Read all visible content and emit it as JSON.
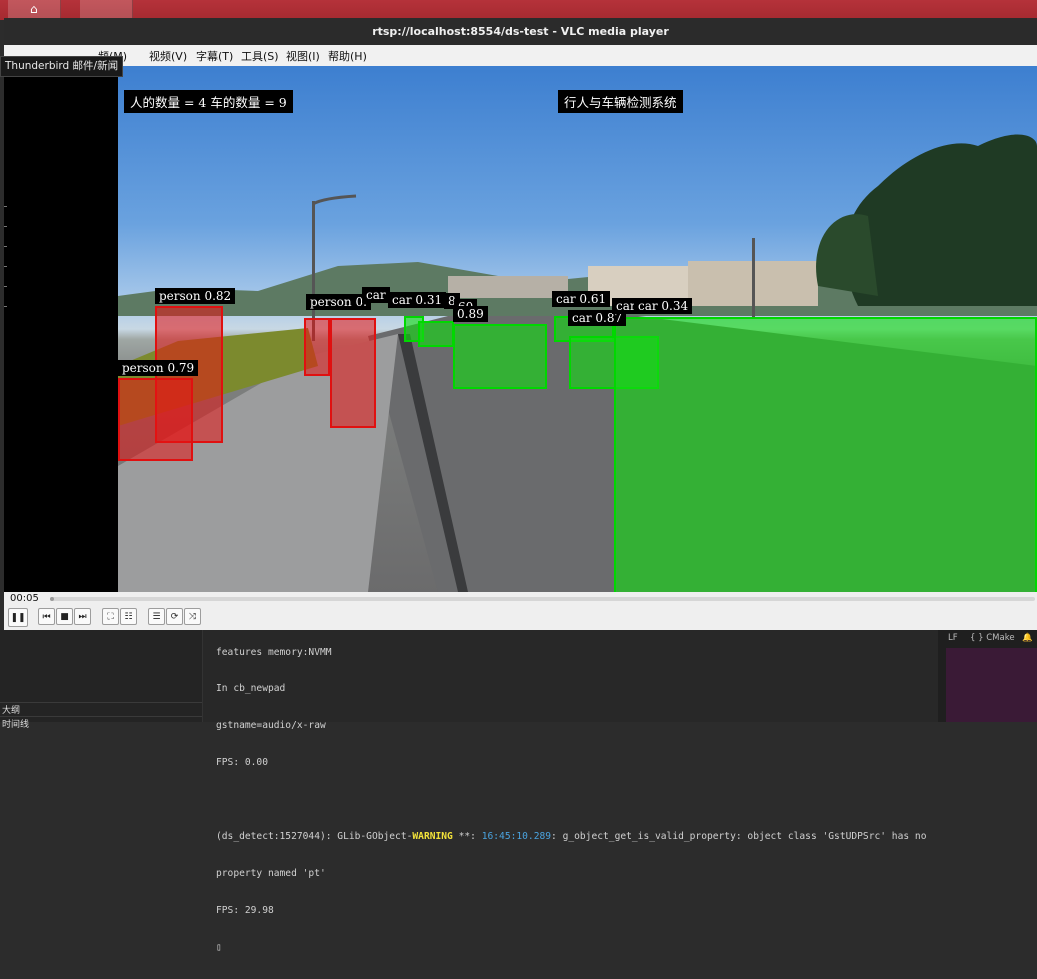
{
  "window": {
    "title": "rtsp://localhost:8554/ds-test - VLC media player"
  },
  "menu": {
    "items": [
      {
        "label": "频(M)"
      },
      {
        "label": "视频(V)"
      },
      {
        "label": "字幕(T)"
      },
      {
        "label": "工具(S)"
      },
      {
        "label": "视图(I)"
      },
      {
        "label": "帮助(H)"
      }
    ]
  },
  "tooltip": {
    "text": "Thunderbird 邮件/新闻"
  },
  "video": {
    "count_overlay": "人的数量 = 4 车的数量 = 9",
    "system_title": "行人与车辆检测系统",
    "detections": [
      {
        "label": "person 0.82",
        "class": "person"
      },
      {
        "label": "person 0.79",
        "class": "person"
      },
      {
        "label": "person 0.",
        "class": "person"
      },
      {
        "label": "car",
        "class": "car"
      },
      {
        "label": "car 0.31",
        "class": "car"
      },
      {
        "label": "8",
        "class": "car"
      },
      {
        "label": "60",
        "class": "car"
      },
      {
        "label": "0.89",
        "class": "car"
      },
      {
        "label": "car 0.61",
        "class": "car"
      },
      {
        "label": "car 0.87",
        "class": "car"
      },
      {
        "label": "car",
        "class": "car"
      },
      {
        "label": "car 0.34",
        "class": "car"
      }
    ]
  },
  "player": {
    "elapsed": "00:05",
    "progress": 0.004,
    "controls": [
      {
        "icon": "pause-icon",
        "glyph": "❚❚"
      },
      {
        "icon": "previous-icon",
        "glyph": "⏮"
      },
      {
        "icon": "stop-icon",
        "glyph": "■"
      },
      {
        "icon": "next-icon",
        "glyph": "⏭"
      },
      {
        "icon": "fullscreen-icon",
        "glyph": "⛶"
      },
      {
        "icon": "extended-settings-icon",
        "glyph": "☷"
      },
      {
        "icon": "playlist-icon",
        "glyph": "☰"
      },
      {
        "icon": "loop-icon",
        "glyph": "⟳"
      },
      {
        "icon": "shuffle-icon",
        "glyph": "⤨"
      }
    ]
  },
  "terminal": {
    "lines": [
      "features memory:NVMM",
      "In cb_newpad",
      "gstname=audio/x-raw",
      "FPS: 0.00",
      "",
      "(ds_detect:1527044): GLib-GObject-WARNING **: 16:45:10.289: g_object_get_is_valid_property: object class 'GstUDPSrc' has no",
      "property named 'pt'",
      "FPS: 29.98",
      "▯"
    ],
    "warning_word": "WARNING",
    "timestamp": "16:45:10.289",
    "sidebar": {
      "outline_label": "大纲",
      "second_label": "时间线"
    },
    "status": {
      "eol": "LF",
      "language": "{ } CMake",
      "icon": "bell-icon"
    }
  }
}
